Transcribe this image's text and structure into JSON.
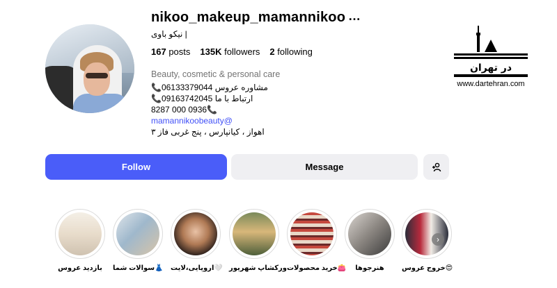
{
  "profile": {
    "username": "nikoo_makeup_mamannikoo",
    "more_icon": "…",
    "full_name": "نیکو باوی |",
    "stats": {
      "posts_count": "167",
      "posts_label": "posts",
      "followers_count": "135K",
      "followers_label": "followers",
      "following_count": "2",
      "following_label": "following"
    },
    "category": "Beauty, cosmetic & personal care",
    "bio_lines": [
      "📞06133379044 مشاوره عروس",
      "📞09163742045 ارتباط با ما",
      "8287 000 0936📞",
      "mamannikoobeauty@",
      "اهواز ، کیانپارس ، پنج غربی فاز ۳"
    ]
  },
  "logo": {
    "text": "در تهران",
    "url": "www.dartehran.com"
  },
  "actions": {
    "follow": "Follow",
    "message": "Message",
    "add_user_icon": "person-add-icon"
  },
  "highlights": [
    {
      "label": "بازدید عروس"
    },
    {
      "label": "سوالات شما👗"
    },
    {
      "label": "اروپایی،لایت🤍"
    },
    {
      "label": "ورکشاپ شهریور"
    },
    {
      "label": "خرید محصولات👛"
    },
    {
      "label": "هنرجوها"
    },
    {
      "label": "خروج عروس😍"
    }
  ],
  "colors": {
    "accent": "#4a5df9",
    "link": "#4150f7",
    "secondary_button": "#efeff2",
    "muted_text": "#737373"
  }
}
